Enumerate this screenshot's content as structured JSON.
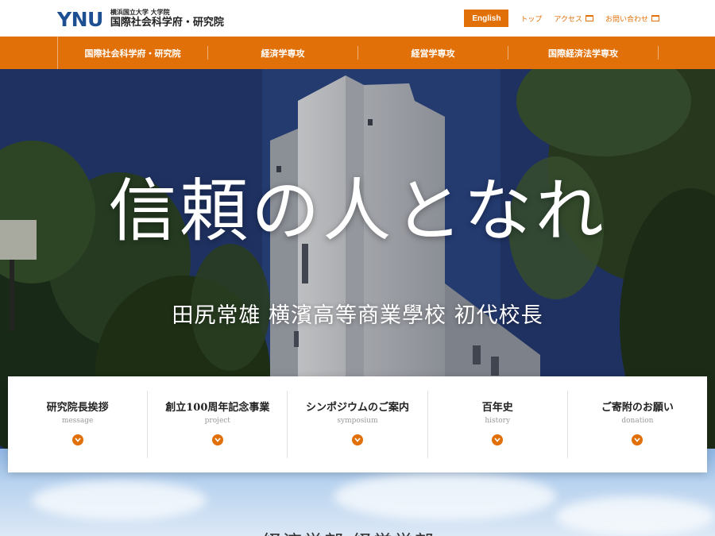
{
  "header": {
    "logo_mark": "YNU",
    "logo_sub": "横浜国立大学 大学院",
    "logo_main": "国際社会科学府・研究院",
    "english_button": "English",
    "links": [
      {
        "label": "トップ",
        "external": false
      },
      {
        "label": "アクセス",
        "external": true
      },
      {
        "label": "お問い合わせ",
        "external": true
      }
    ]
  },
  "nav": {
    "items": [
      {
        "label": "国際社会科学府・研究院"
      },
      {
        "label": "経済学専攻"
      },
      {
        "label": "経営学専攻"
      },
      {
        "label": "国際経済法学専攻"
      }
    ]
  },
  "hero": {
    "title": "信頼の人となれ",
    "subtitle": "田尻常雄 横濱高等商業學校 初代校長"
  },
  "cards": [
    {
      "title": "研究院長挨拶",
      "en": "message"
    },
    {
      "title": "創立100周年記念事業",
      "en": "project"
    },
    {
      "title": "シンポジウムのご案内",
      "en": "symposium"
    },
    {
      "title": "百年史",
      "en": "history"
    },
    {
      "title": "ご寄附のお願い",
      "en": "donation"
    }
  ],
  "section": {
    "heading": "経済学部 経営学部"
  },
  "colors": {
    "accent": "#e07007",
    "brand_blue": "#1d4f93"
  }
}
